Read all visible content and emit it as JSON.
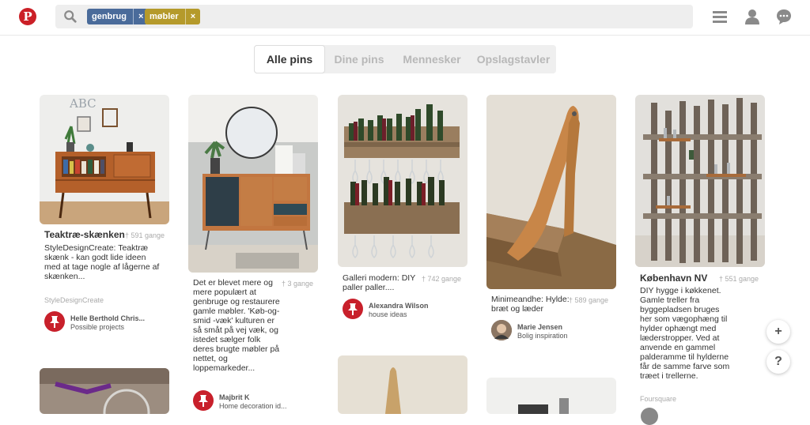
{
  "header": {
    "logo": "P",
    "tags": [
      {
        "label": "genbrug",
        "remove": "×",
        "color": "#4a6b9a"
      },
      {
        "label": "møbler",
        "remove": "×",
        "color": "#b59a2b"
      }
    ],
    "icons": [
      "search-icon",
      "menu-icon",
      "user-icon",
      "messages-icon"
    ]
  },
  "tabs": [
    "Alle pins",
    "Dine pins",
    "Mennesker",
    "Opslagstavler"
  ],
  "pins": [
    {
      "title": "Teaktræ-skænken",
      "saves": "591 gange",
      "desc": "StyleDesignCreate: Teaktræ skænk - kan godt lide ideen med at tage nogle af lågerne af skænken...",
      "source": "StyleDesignCreate",
      "user": "Helle Berthold Chris...",
      "board": "Possible projects"
    },
    {
      "title": "",
      "saves": "3 gange",
      "desc": "Det er blevet mere og mere populært at genbruge og restaurere gamle møbler. 'Køb-og-smid -væk' kulturen er så småt på vej væk, og istedet sælger folk deres brugte møbler på nettet, og loppemarkeder...",
      "source": "",
      "user": "Majbrit K",
      "board": "Home decoration id..."
    },
    {
      "title": "",
      "saves": "742 gange",
      "desc": "Galleri modern: DIY paller paller....",
      "source": "",
      "user": "Alexandra Wilson",
      "board": "house ideas"
    },
    {
      "title": "",
      "saves": "589 gange",
      "desc": "Minimeandhe: Hylde: bræt og læder",
      "source": "",
      "user": "Marie Jensen",
      "board": "Bolig inspiration"
    },
    {
      "title": "København NV",
      "saves": "551 gange",
      "desc": "DIY hygge i køkkenet. Gamle treller fra byggepladsen bruges her som vægophæng til hylder ophængt med læderstropper. Ved at anvende en gammel palderamme til hylderne får de samme farve som træet i trellerne.",
      "source": "Foursquare",
      "user": "",
      "board": ""
    }
  ],
  "fabs": {
    "add": "+",
    "help": "?"
  },
  "colors": {
    "brand": "#cb2027",
    "avatar": "#c8202b"
  }
}
